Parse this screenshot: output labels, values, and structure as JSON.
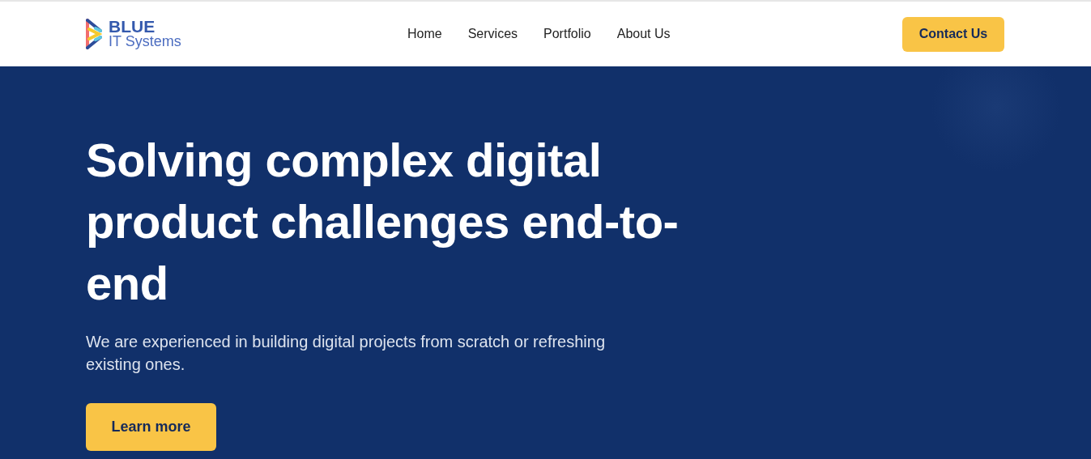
{
  "header": {
    "logo": {
      "line_1": "BLUE",
      "line_2": "IT Systems"
    },
    "nav": [
      {
        "label": "Home"
      },
      {
        "label": "Services"
      },
      {
        "label": "Portfolio"
      },
      {
        "label": "About Us"
      }
    ],
    "cta": "Contact Us"
  },
  "hero": {
    "heading": "Solving complex digital product challenges end-to-end",
    "text": "We are experienced in building digital projects from scratch or refreshing existing ones.",
    "button": "Learn more"
  }
}
